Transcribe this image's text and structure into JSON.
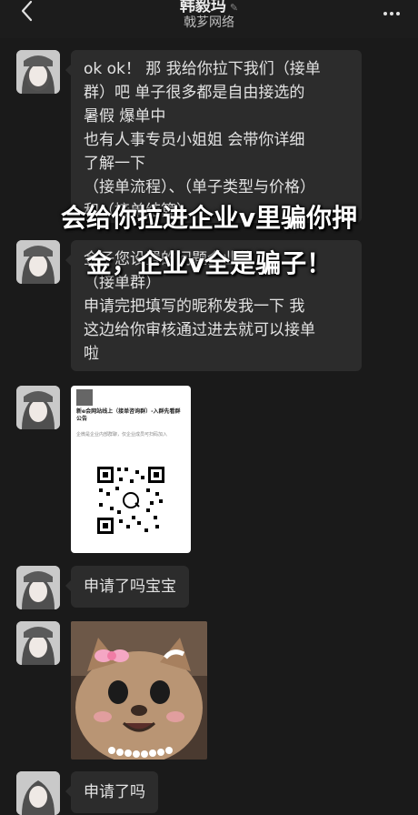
{
  "header": {
    "contact_name": "韩毅玛",
    "company": "戟芗网络"
  },
  "messages": [
    {
      "type": "text",
      "lines": [
        "ok ok！ 那 我给你拉下我们（接单",
        "群）吧 单子很多都是自由接选的",
        "暑假 爆单中",
        "也有人事专员小姐姐 会带你详细",
        "了解一下",
        "（接单流程）、（单子类型与价格）",
        "和（接单结算）"
      ]
    },
    {
      "type": "text",
      "lines": [
        "金子您设置的问题企业的",
        "（接单群）",
        "申请完把填写的昵称发我一下 我",
        "这边给你审核通过进去就可以接单",
        "啦"
      ]
    },
    {
      "type": "card",
      "title": "新e会网站线上（接单咨询群）-入群先看群公告",
      "desc": "企微是企业内部群聊，仅企业成员可扫码加入"
    },
    {
      "type": "text",
      "text": "申请了吗宝宝"
    },
    {
      "type": "image",
      "description": "cat"
    },
    {
      "type": "text",
      "text": "申请了吗"
    }
  ],
  "overlay": {
    "line1": "会给你拉进企业v里骗你押",
    "line2": "金，企业v全是骗子！"
  }
}
